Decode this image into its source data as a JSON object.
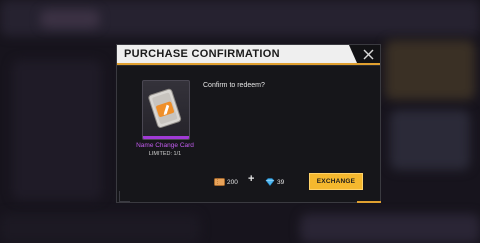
{
  "dialog": {
    "title": "PURCHASE CONFIRMATION",
    "close_icon": "close-icon",
    "confirm_text": "Confirm to redeem?"
  },
  "item": {
    "name": "Name Change Card",
    "limit": "LIMITED: 1/1",
    "icon": "name-change-card-icon",
    "rarity_color": "#a13bd6"
  },
  "cost": {
    "vouchers": "200",
    "voucher_icon": "voucher-icon",
    "plus": "+",
    "diamonds": "39",
    "diamond_icon": "diamond-icon"
  },
  "actions": {
    "exchange_label": "EXCHANGE"
  },
  "colors": {
    "accent": "#e0a030",
    "button": "#f5b82e",
    "item_name": "#c35cf0"
  }
}
